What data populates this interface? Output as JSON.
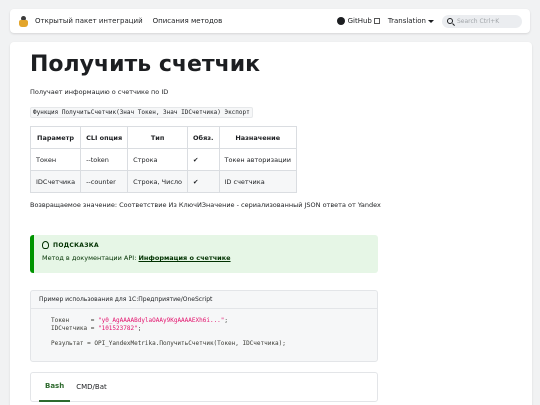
{
  "navbar": {
    "links": [
      "Открытый пакет интеграций",
      "Описания методов"
    ],
    "github_label": "GitHub",
    "translation_label": "Translation",
    "search_placeholder": "Search Ctrl+K"
  },
  "page": {
    "title": "Получить счетчик",
    "description": "Получает информацию о счетчике по ID",
    "signature": "Функция ПолучитьСчетчик(Знач Токен, Знач IDСчетчика) Экспорт",
    "table": {
      "headers": [
        "Параметр",
        "CLI опция",
        "Тип",
        "Обяз.",
        "Назначение"
      ],
      "rows": [
        [
          "Токен",
          "--token",
          "Строка",
          "✔",
          "Токен авторизации"
        ],
        [
          "IDСчетчика",
          "--counter",
          "Строка, Число",
          "✔",
          "ID счетчика"
        ]
      ]
    },
    "returns": "Возвращаемое значение: Соответствие Из КлючИЗначение - сериализованный JSON ответа от Yandex"
  },
  "tip": {
    "label": "ПОДСКАЗКА",
    "text_prefix": "Метод в документации API: ",
    "link": "Информация о счетчике"
  },
  "code": {
    "title": "Пример использования для 1С:Предприятие/OneScript",
    "line1_var": "Токен      = ",
    "line1_val": "\"y0_AgAAAABdylaOAAy9KgAAAAEXh6i...\"",
    "line2_var": "IDСчетчика = ",
    "line2_val": "\"101523782\"",
    "line4": "Результат = OPI_YandexMetrika.ПолучитьСчетчик(Токен, IDСчетчика);"
  },
  "tabs": [
    "Bash",
    "CMD/Bat"
  ],
  "colors": {
    "accent": "#2e6a2e",
    "tip_border": "#009400",
    "tip_bg": "#e6f6e6",
    "string": "#e3116c"
  }
}
